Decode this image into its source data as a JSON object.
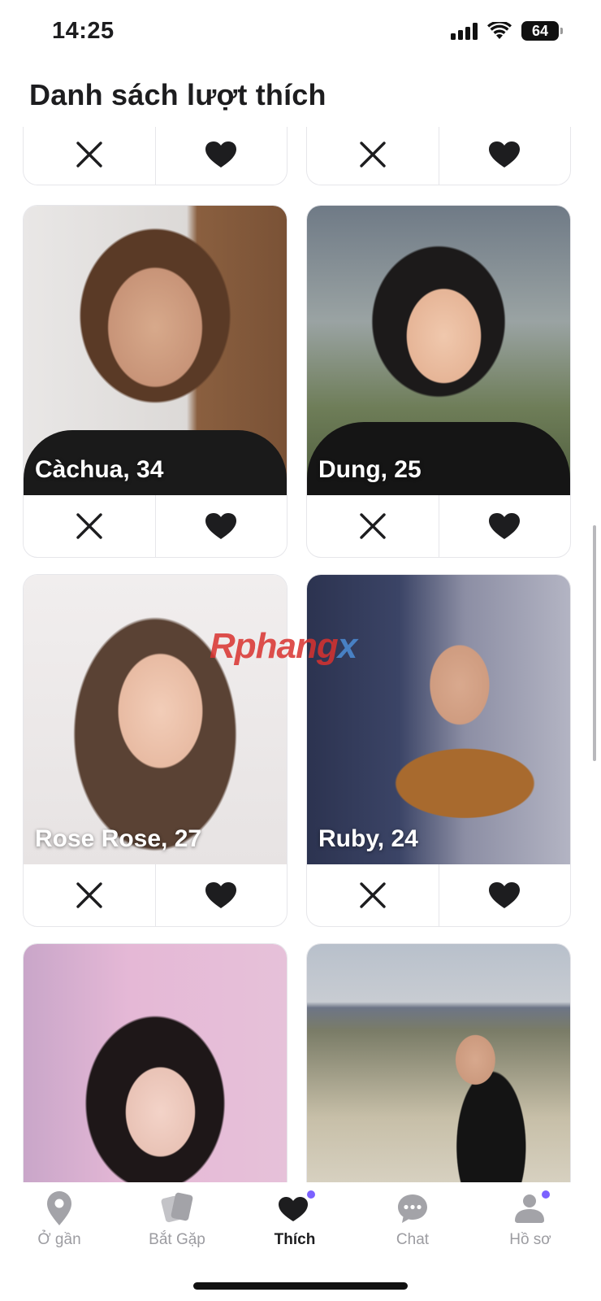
{
  "status_bar": {
    "time": "14:25",
    "battery": "64"
  },
  "header": {
    "title": "Danh sách lượt thích"
  },
  "cards": [
    {
      "name": "Càchua, 34"
    },
    {
      "name": "Dung, 25"
    },
    {
      "name": "Rose Rose, 27"
    },
    {
      "name": "Ruby, 24"
    },
    {
      "name": ""
    },
    {
      "name": ""
    }
  ],
  "watermark": "Rphangx",
  "tabs": [
    {
      "label": "Ở gần",
      "icon": "location-pin-icon",
      "active": false
    },
    {
      "label": "Bắt Gặp",
      "icon": "cards-icon",
      "active": false
    },
    {
      "label": "Thích",
      "icon": "heart-icon",
      "active": true,
      "badge": true
    },
    {
      "label": "Chat",
      "icon": "chat-bubble-icon",
      "active": false
    },
    {
      "label": "Hồ sơ",
      "icon": "profile-icon",
      "active": false,
      "badge": true
    }
  ],
  "colors": {
    "accent_badge": "#7b61ff",
    "icon_dark": "#1d1d1f",
    "icon_inactive": "#a3a3a8",
    "card_border": "#e6e6ea"
  }
}
